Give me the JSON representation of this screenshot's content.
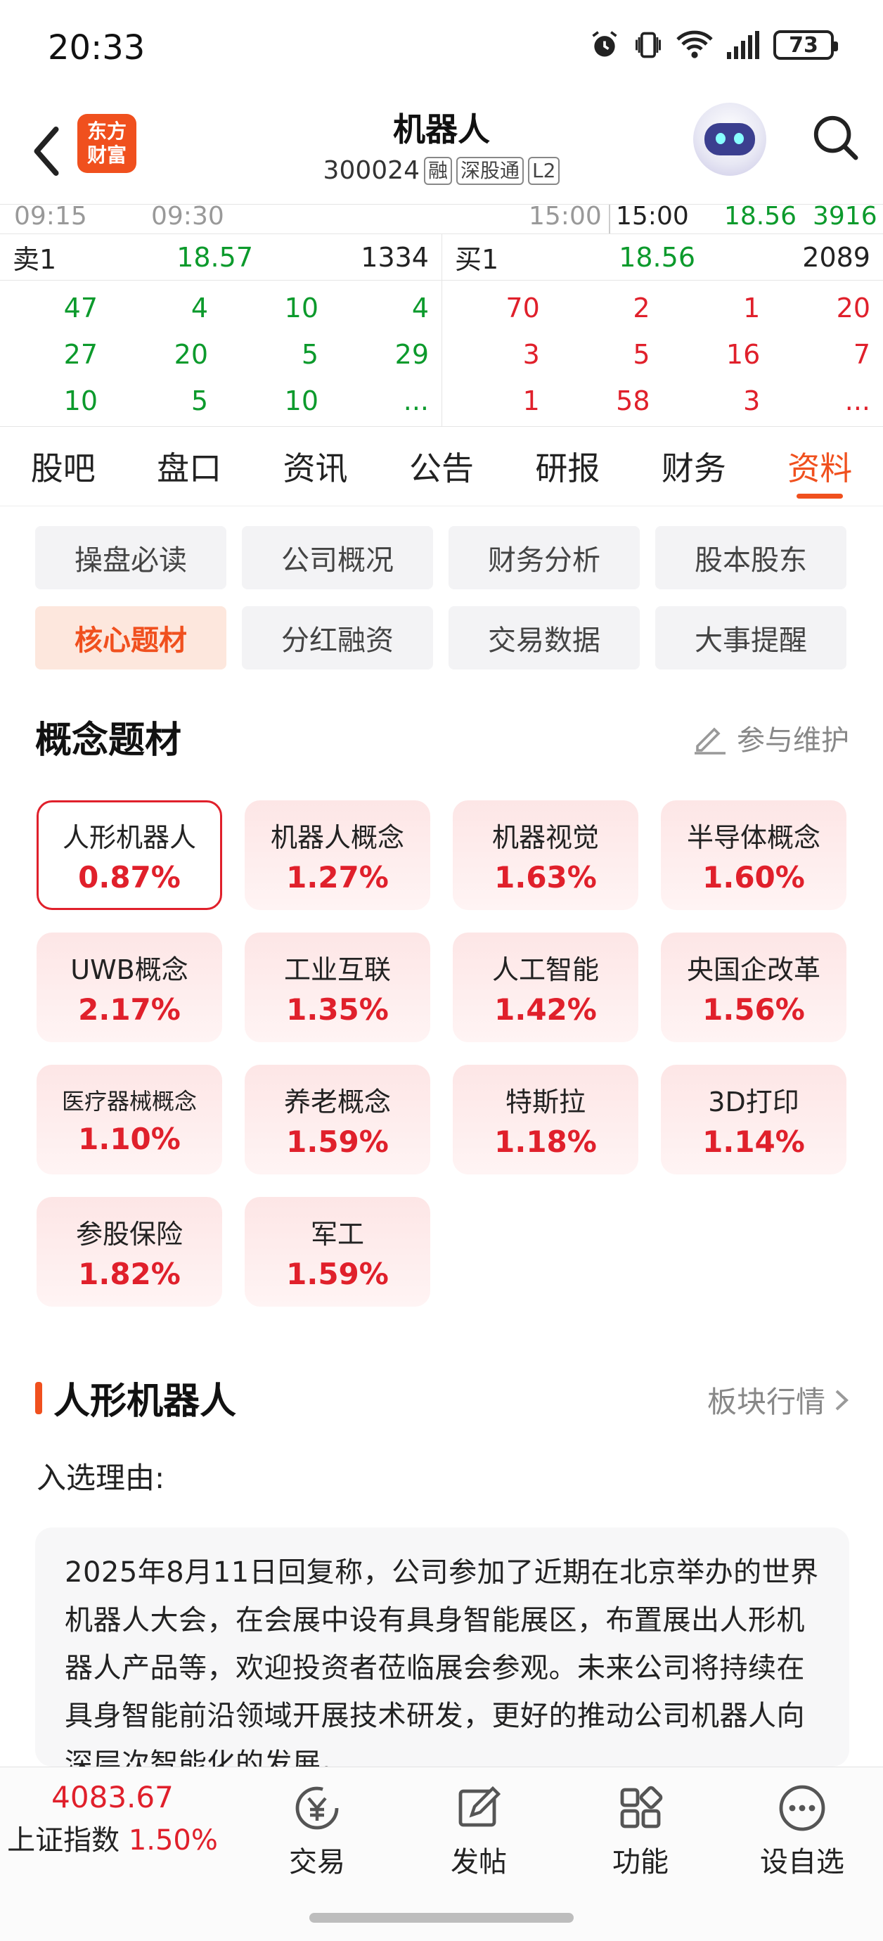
{
  "status_bar": {
    "time": "20:33",
    "battery": "73"
  },
  "header": {
    "logo_line1": "东方",
    "logo_line2": "财富",
    "stock_name": "机器人",
    "stock_code": "300024",
    "tags": [
      "融",
      "深股通",
      "L2"
    ]
  },
  "quote": {
    "time_labels": [
      "09:15",
      "09:30",
      "15:00"
    ],
    "last_trade": {
      "time": "15:00",
      "price": "18.56",
      "volume": "3916"
    },
    "sell": {
      "label": "卖1",
      "price": "18.57",
      "volume": "1334",
      "queue": [
        "47",
        "4",
        "10",
        "4",
        "27",
        "20",
        "5",
        "29",
        "10",
        "5",
        "10",
        "..."
      ]
    },
    "buy": {
      "label": "买1",
      "price": "18.56",
      "volume": "2089",
      "queue": [
        "70",
        "2",
        "1",
        "20",
        "3",
        "5",
        "16",
        "7",
        "1",
        "58",
        "3",
        "..."
      ]
    }
  },
  "tabs": [
    {
      "label": "股吧",
      "active": false
    },
    {
      "label": "盘口",
      "active": false
    },
    {
      "label": "资讯",
      "active": false
    },
    {
      "label": "公告",
      "active": false
    },
    {
      "label": "研报",
      "active": false
    },
    {
      "label": "财务",
      "active": false
    },
    {
      "label": "资料",
      "active": true
    }
  ],
  "submenu": [
    {
      "label": "操盘必读",
      "active": false
    },
    {
      "label": "公司概况",
      "active": false
    },
    {
      "label": "财务分析",
      "active": false
    },
    {
      "label": "股本股东",
      "active": false
    },
    {
      "label": "核心题材",
      "active": true
    },
    {
      "label": "分红融资",
      "active": false
    },
    {
      "label": "交易数据",
      "active": false
    },
    {
      "label": "大事提醒",
      "active": false
    }
  ],
  "concept_section": {
    "title": "概念题材",
    "maintain_label": "参与维护"
  },
  "concepts": [
    {
      "name": "人形机器人",
      "pct": "0.87%",
      "selected": true
    },
    {
      "name": "机器人概念",
      "pct": "1.27%"
    },
    {
      "name": "机器视觉",
      "pct": "1.63%"
    },
    {
      "name": "半导体概念",
      "pct": "1.60%"
    },
    {
      "name": "UWB概念",
      "pct": "2.17%"
    },
    {
      "name": "工业互联",
      "pct": "1.35%"
    },
    {
      "name": "人工智能",
      "pct": "1.42%"
    },
    {
      "name": "央国企改革",
      "pct": "1.56%"
    },
    {
      "name": "医疗器械概念",
      "pct": "1.10%",
      "small": true
    },
    {
      "name": "养老概念",
      "pct": "1.59%"
    },
    {
      "name": "特斯拉",
      "pct": "1.18%"
    },
    {
      "name": "3D打印",
      "pct": "1.14%"
    },
    {
      "name": "参股保险",
      "pct": "1.82%"
    },
    {
      "name": "军工",
      "pct": "1.59%"
    }
  ],
  "detail": {
    "title": "人形机器人",
    "board_link": "板块行情",
    "reason_label": "入选理由:",
    "reason_text": "2025年8月11日回复称，公司参加了近期在北京举办的世界机器人大会，在会展中设有具身智能展区，布置展出人形机器人产品等，欢迎投资者莅临展会参观。未来公司将持续在具身智能前沿领域开展技术研发，更好的推动公司机器人向深层次智能化的发展。"
  },
  "bottom_nav": {
    "index_value": "4083.67",
    "index_name": "上证指数",
    "index_change": "1.50%",
    "items": [
      {
        "label": "交易",
        "icon": "trade-yen-icon"
      },
      {
        "label": "发帖",
        "icon": "compose-icon"
      },
      {
        "label": "功能",
        "icon": "grid-apps-icon"
      },
      {
        "label": "设自选",
        "icon": "more-dots-icon"
      }
    ]
  },
  "colors": {
    "accent": "#f0501e",
    "up": "#e0202b",
    "down": "#0c9a2c"
  }
}
